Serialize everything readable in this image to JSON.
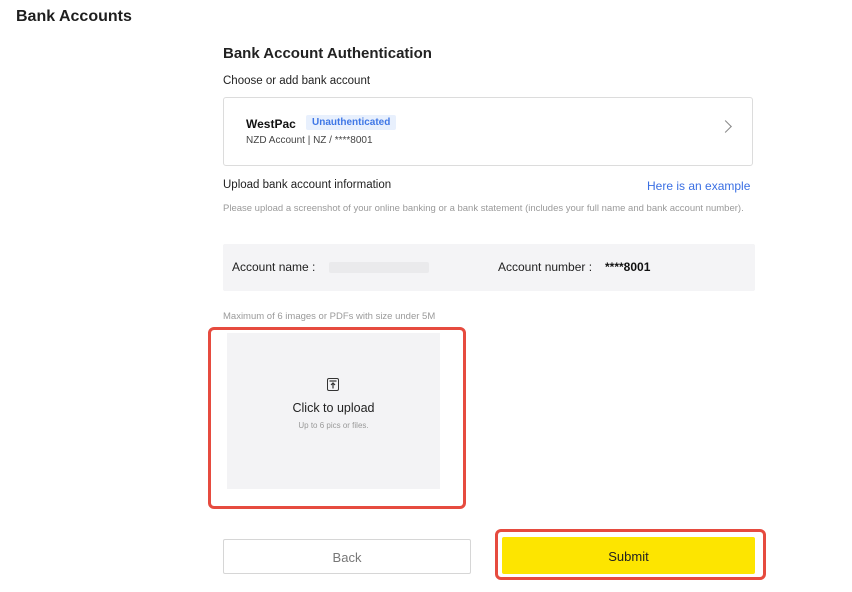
{
  "header": {
    "title": "Bank Accounts"
  },
  "form": {
    "title": "Bank Account Authentication",
    "choose_label": "Choose or add bank account",
    "account": {
      "bank": "WestPac",
      "status": "Unauthenticated",
      "description": "NZD Account  |  NZ / ****8001"
    },
    "upload_label": "Upload bank account information",
    "example_link": "Here is an example",
    "help_text": "Please upload a screenshot of your online banking or a bank statement (includes your full name and bank account number).",
    "info": {
      "account_name_label": "Account name :",
      "account_number_label": "Account number :",
      "account_number_value": "****8001"
    },
    "max_text": "Maximum of 6 images or PDFs with size under 5M",
    "upload": {
      "title": "Click to upload",
      "subtitle": "Up to 6 pics or files."
    },
    "buttons": {
      "back": "Back",
      "submit": "Submit"
    }
  },
  "colors": {
    "accent": "#fde500",
    "highlight": "#e64b3f",
    "link": "#3a6fe3",
    "badge_bg": "#e8f0fd"
  }
}
